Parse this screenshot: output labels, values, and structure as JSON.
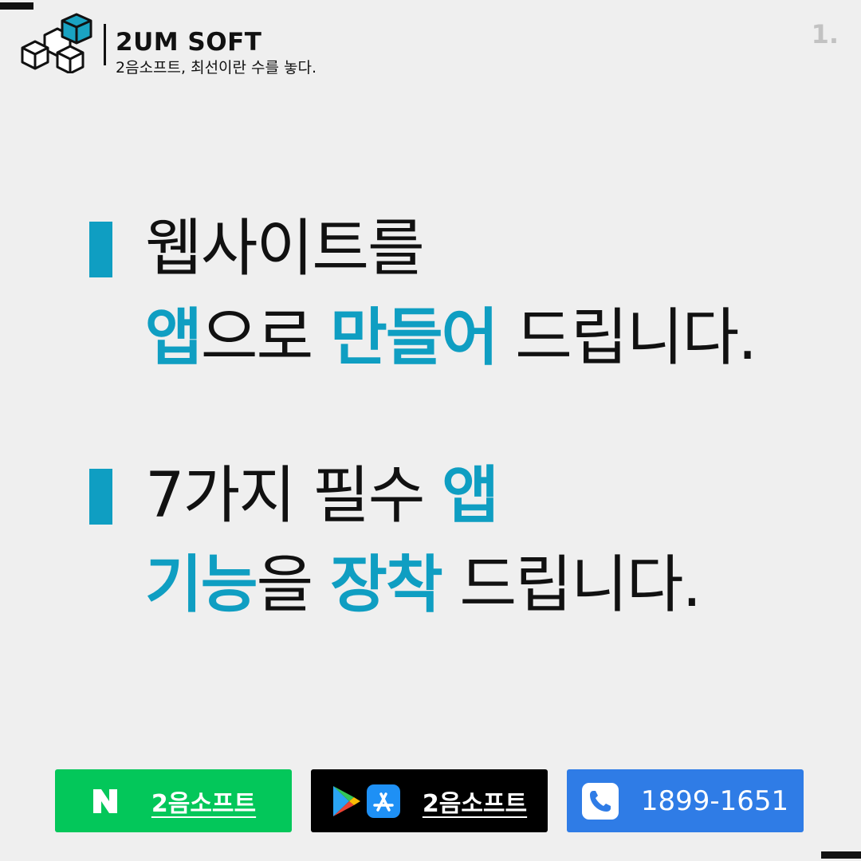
{
  "brand": {
    "name": "2UM SOFT",
    "tagline": "2음소프트, 최선이란 수를 놓다."
  },
  "page_number": "1.",
  "headline": {
    "block1": {
      "line1": {
        "part1": "웹사이트",
        "part2": "를"
      },
      "line2": {
        "part1": "앱",
        "part2": "으로 ",
        "part3": "만들어",
        "part4": " 드립니다."
      }
    },
    "block2": {
      "line1": {
        "part1": "7가지 필수 ",
        "part2": "앱"
      },
      "line2": {
        "part1": "기능",
        "part2": "을 ",
        "part3": "장착",
        "part4": " 드립니다."
      }
    }
  },
  "buttons": {
    "naver": {
      "label": "2음소프트",
      "icon": "naver-n-icon",
      "color": "#03c75a"
    },
    "stores": {
      "label": "2음소프트",
      "icons": [
        "google-play-icon",
        "app-store-icon"
      ],
      "color": "#000000"
    },
    "phone": {
      "label": "1899-1651",
      "icon": "phone-icon",
      "color": "#2f7ce6"
    }
  },
  "colors": {
    "accent": "#0f9ec2",
    "background": "#efefef"
  }
}
